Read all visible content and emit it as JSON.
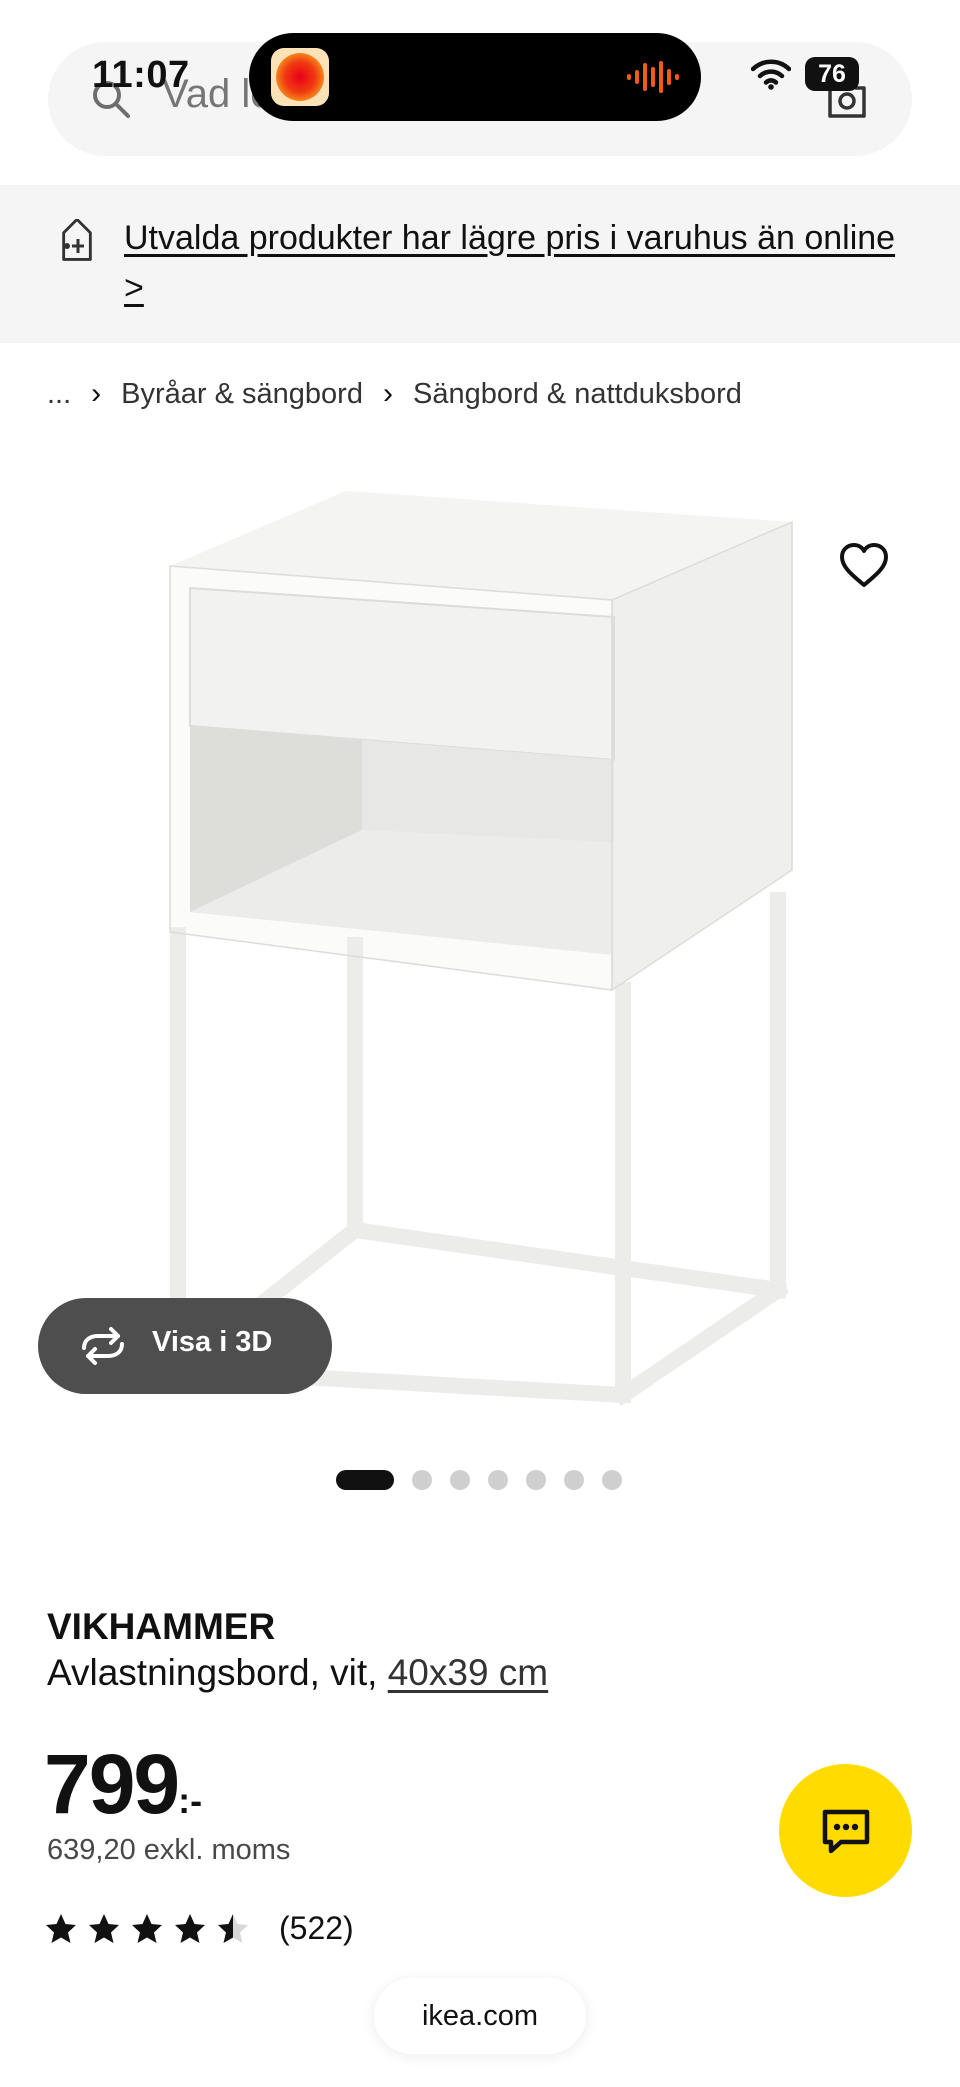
{
  "status_bar": {
    "time": "11:07",
    "battery": "76"
  },
  "search": {
    "placeholder": "Vad letar du efter?"
  },
  "promo": {
    "text": "Utvalda produkter har lägre pris i varuhus än online >"
  },
  "breadcrumb": {
    "items": [
      "...",
      "Byråar & sängbord",
      "Sängbord & nattduksbord"
    ]
  },
  "gallery": {
    "view_3d_label": "Visa i 3D",
    "image_count": 7,
    "active_index": 0
  },
  "product": {
    "name": "VIKHAMMER",
    "description": "Avlastningsbord, vit, ",
    "size": "40x39 cm",
    "price_main": "799",
    "price_suffix": ":-",
    "price_excl": "639,20 exkl. moms",
    "rating_stars": 4.5,
    "rating_count": "(522)"
  },
  "browser": {
    "url": "ikea.com"
  },
  "colors": {
    "accent_yellow": "#ffdb00",
    "text": "#111111",
    "banner_bg": "#f5f5f5"
  },
  "icons": [
    "search-icon",
    "camera-icon",
    "wifi-icon",
    "price-tag-icon",
    "heart-icon",
    "rotate-3d-icon",
    "star-icon",
    "chat-icon"
  ]
}
